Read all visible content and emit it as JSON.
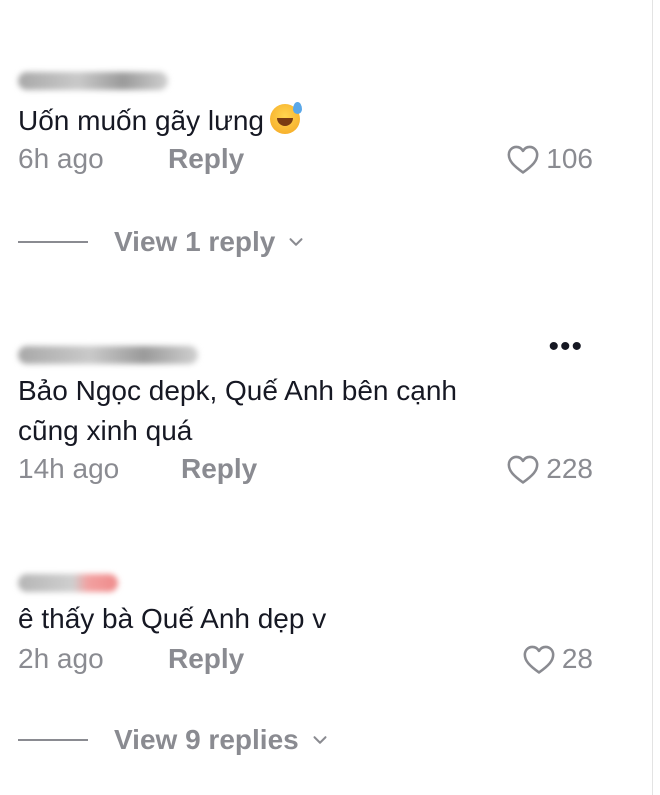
{
  "comments": [
    {
      "text": "Uốn muốn gãy lưng",
      "emoji": "grinning-sweat-emoji",
      "time": "6h ago",
      "reply_label": "Reply",
      "likes": "106"
    },
    {
      "text": "Bảo Ngọc depk, Quế Anh bên cạnh\ncũng xinh quá",
      "time": "14h ago",
      "reply_label": "Reply",
      "likes": "228",
      "more_label": "•••"
    },
    {
      "text": "ê thấy bà Quế Anh dẹp v",
      "time": "2h ago",
      "reply_label": "Reply",
      "likes": "28"
    }
  ],
  "view_replies": [
    {
      "label": "View 1 reply"
    },
    {
      "label": "View 9 replies"
    }
  ],
  "colors": {
    "text": "#161823",
    "muted": "#8a8b91"
  },
  "icons": {
    "like": "heart-outline-icon",
    "expand": "chevron-down-icon",
    "more": "more-horizontal-icon"
  }
}
